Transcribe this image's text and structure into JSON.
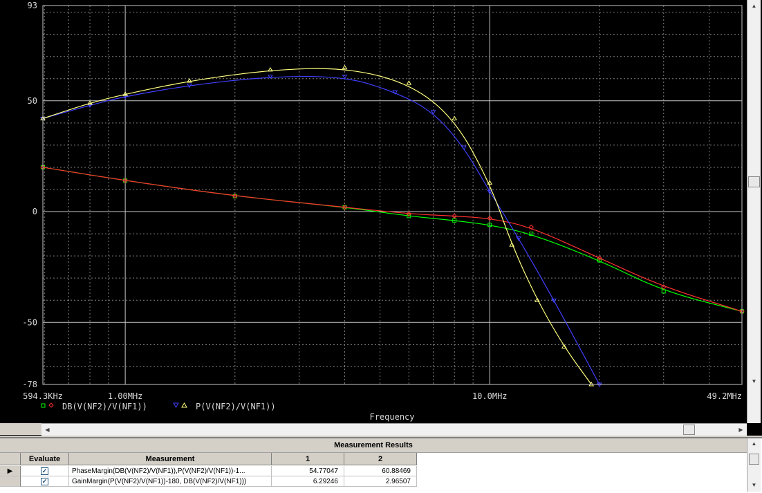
{
  "plot": {
    "x_axis_label": "Frequency",
    "x_ticks": [
      "594.3KHz",
      "1.00MHz",
      "10.0MHz",
      "49.2MHz"
    ],
    "y_ticks": [
      "93",
      "50",
      "0",
      "-50",
      "-78"
    ],
    "legend": [
      {
        "markers": "□ ◇",
        "label": "DB(V(NF2)/V(NF1))",
        "marker_colors": [
          "#00ff00",
          "#ff3030"
        ]
      },
      {
        "markers": "▽ △",
        "label": "P(V(NF2)/V(NF1))",
        "marker_colors": [
          "#4040ff",
          "#ffff80"
        ]
      }
    ]
  },
  "chart_data": {
    "type": "line",
    "xlabel": "Frequency",
    "ylabel": "",
    "x_scale": "log",
    "xlim": [
      594300,
      49200000
    ],
    "ylim": [
      -78,
      93
    ],
    "series": [
      {
        "name": "DB(V(NF2)/V(NF1))",
        "color": "#00ff00",
        "marker": "square",
        "x": [
          594300,
          1000000,
          2000000,
          4000000,
          6000000,
          8000000,
          10000000,
          13000000,
          20000000,
          30000000,
          49200000
        ],
        "y": [
          20,
          14,
          7,
          2,
          -2,
          -4,
          -6,
          -10,
          -22,
          -36,
          -45
        ]
      },
      {
        "name": "DB(V(NF2)/V(NF1))",
        "color": "#ff3030",
        "marker": "diamond",
        "x": [
          594300,
          1000000,
          2000000,
          4000000,
          6000000,
          8000000,
          10000000,
          13000000,
          20000000,
          30000000,
          49200000
        ],
        "y": [
          20,
          14,
          7,
          2,
          -1,
          -2,
          -3,
          -7,
          -21,
          -34,
          -45
        ]
      },
      {
        "name": "P(V(NF2)/V(NF1))",
        "color": "#4040ff",
        "marker": "triangle-down",
        "x": [
          594300,
          800000,
          1000000,
          1500000,
          2500000,
          4000000,
          5500000,
          7000000,
          8500000,
          10000000,
          12000000,
          15000000,
          20000000
        ],
        "y": [
          42,
          48,
          52,
          57,
          61,
          61,
          54,
          45,
          29,
          9,
          -12,
          -40,
          -78
        ]
      },
      {
        "name": "P(V(NF2)/V(NF1))",
        "color": "#ffff80",
        "marker": "triangle-up",
        "x": [
          594300,
          800000,
          1000000,
          1500000,
          2500000,
          4000000,
          6000000,
          8000000,
          10000000,
          11500000,
          13500000,
          16000000,
          19000000
        ],
        "y": [
          42,
          49,
          53,
          59,
          64,
          65,
          58,
          42,
          13,
          -15,
          -40,
          -61,
          -78
        ]
      }
    ]
  },
  "measurements": {
    "title": "Measurement Results",
    "columns": [
      "Evaluate",
      "Measurement",
      "1",
      "2"
    ],
    "rows": [
      {
        "evaluate": true,
        "measurement": "PhaseMargin(DB(V(NF2)/V(NF1)),P(V(NF2)/V(NF1))-1...",
        "v1": "54.77047",
        "v2": "60.88469"
      },
      {
        "evaluate": true,
        "measurement": "GainMargin(P(V(NF2)/V(NF1))-180, DB(V(NF2)/V(NF1)))",
        "v1": "6.29246",
        "v2": "2.96507"
      }
    ]
  },
  "icons": {
    "row_pointer": "row-pointer-icon",
    "checkbox": "checkbox-checked-icon",
    "scroll": [
      "scroll-up-arrow-icon",
      "scroll-down-arrow-icon",
      "scroll-left-arrow-icon",
      "scroll-right-arrow-icon"
    ]
  }
}
